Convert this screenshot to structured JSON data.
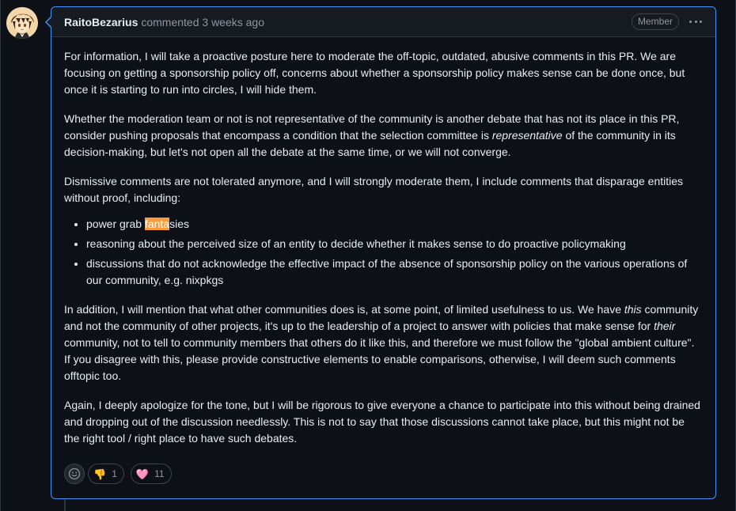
{
  "comment": {
    "author": "RaitoBezarius",
    "action": "commented 3 weeks ago",
    "badge": "Member",
    "paragraphs": [
      {
        "text": "For information, I will take a proactive posture here to moderate the off-topic, outdated, abusive comments in this PR. We are focusing on getting a sponsorship policy off, concerns about whether a sponsorship policy makes sense can be done once, but once it is starting to run into circles, I will hide them."
      },
      {
        "before": "Whether the moderation team or not is not representative of the community is another debate that has not its place in this PR, consider pushing proposals that encompass a condition that the selection committee is ",
        "em": "representative",
        "after": " of the community in its decision-making, but let's not open all the debate at the same time, or we will not converge."
      },
      {
        "text": "Dismissive comments are not tolerated anymore, and I will strongly moderate them, I include comments that disparage entities without proof, including:"
      }
    ],
    "list": [
      {
        "before": "power grab ",
        "highlight": "fanta",
        "after": "sies"
      },
      {
        "text": "reasoning about the perceived size of an entity to decide whether it makes sense to do proactive policymaking"
      },
      {
        "text": "discussions that do not acknowledge the effective impact of the absence of sponsorship policy on the various operations of our community, e.g. nixpkgs"
      }
    ],
    "paragraph4": {
      "a": "In addition, I will mention that what other communities does is, at some point, of limited usefulness to us. We have ",
      "em1": "this",
      "b": " community and not the community of other projects, it's up to the leadership of a project to answer with policies that make sense for ",
      "em2": "their",
      "c": " community, not to tell to community members that others do it like this, and therefore we must follow the \"global ambient culture\". If you disagree with this, please provide constructive elements to enable comparisons, otherwise, I will deem such comments offtopic too."
    },
    "paragraph5": "Again, I deeply apologize for the tone, but I will be rigorous to give everyone a chance to participate into this without being drained and dropping out of the discussion needlessly. This is not to say that those discussions cannot take place, but this might not be the right tool / right place to have such debates.",
    "reactions": [
      {
        "icon": "thumbs-down-icon",
        "emoji": "👎",
        "count": "1"
      },
      {
        "icon": "heart-icon",
        "emoji": "🩷",
        "count": "11"
      }
    ]
  },
  "colors": {
    "accent": "#4493f8",
    "highlight": "#f99b3a",
    "background": "#0d1117",
    "header": "#161b22"
  }
}
